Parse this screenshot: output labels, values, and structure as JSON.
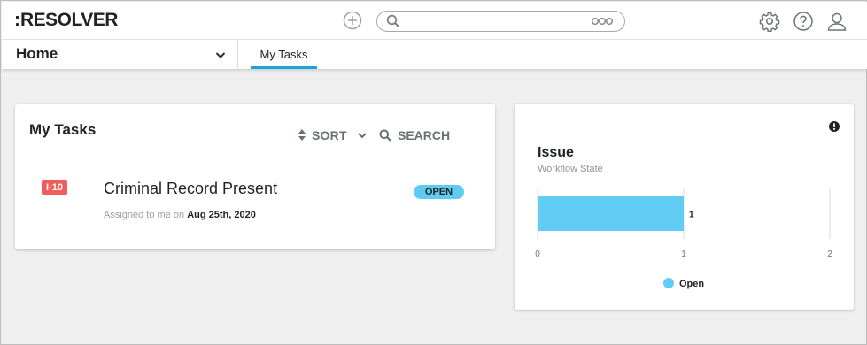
{
  "app": {
    "logo_dots": ":",
    "logo_text": "RESOLVER"
  },
  "topbar": {
    "search_placeholder": "",
    "icons": [
      "add-icon",
      "search-icon",
      "more-options-icon",
      "gear-icon",
      "help-icon",
      "user-icon"
    ]
  },
  "nav": {
    "home_label": "Home",
    "tab_label": "My Tasks"
  },
  "tasks_card": {
    "title": "My Tasks",
    "sort_label": "SORT",
    "search_label": "SEARCH",
    "task": {
      "id": "I-10",
      "name": "Criminal Record Present",
      "meta_prefix": "Assigned to me on",
      "date": "Aug 25th, 2020",
      "status": "OPEN"
    }
  },
  "issue_card": {
    "title": "Issue",
    "subtitle": "Workflow State"
  },
  "colors": {
    "accent": "#1aa3e0",
    "bar": "#62cdf4",
    "badge": "#f25c5c",
    "status": "#5ecbf1"
  },
  "chart_data": {
    "type": "bar",
    "orientation": "horizontal",
    "categories": [
      "Open"
    ],
    "series": [
      {
        "name": "Open",
        "values": [
          1
        ]
      }
    ],
    "data_labels": [
      "1"
    ],
    "xlim": [
      0,
      2
    ],
    "xticks": [
      "0",
      "1",
      "2"
    ],
    "grid": true,
    "legend_placement": "bottom",
    "legend": [
      "Open"
    ]
  }
}
